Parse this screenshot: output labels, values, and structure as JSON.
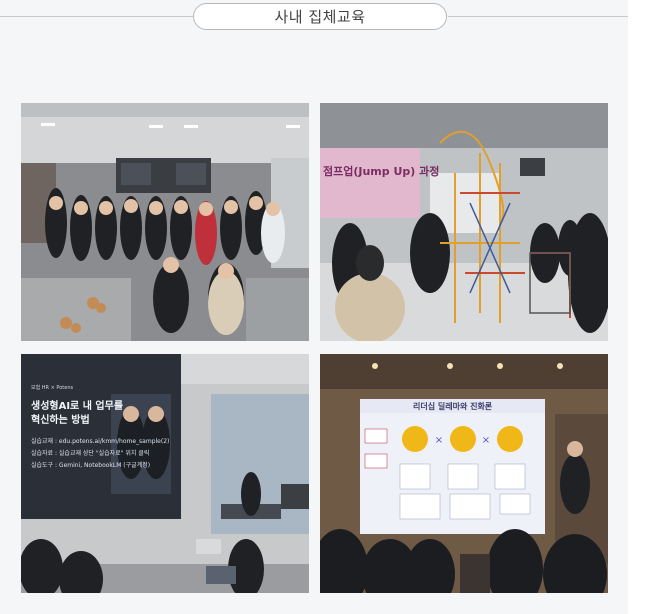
{
  "section": {
    "title": "사내 집체교육"
  },
  "photos": [
    {
      "subject": "group-photo"
    },
    {
      "subject": "jumpup-workshop"
    },
    {
      "subject": "ai-lecture"
    },
    {
      "subject": "leadership-lecture"
    }
  ],
  "slide_ai": {
    "brand": "모험 HR × Potens",
    "title_line1": "생성형AI로 내 업무를",
    "title_line2": "혁신하는 방법",
    "line1": "실습교재 : edu.potens.ai/kmm/home_sample(2)",
    "line2": "실습자료 : 실습교재 상단 \"실습자료\" 위치 클릭",
    "line3": "실습도구 : Gemini, NotebookLM (구글계정)"
  },
  "banner_jumpup": {
    "text": "점프업(Jump Up) 과정"
  },
  "slide_leadership": {
    "title": "리더십 딜레마와 진화론"
  }
}
